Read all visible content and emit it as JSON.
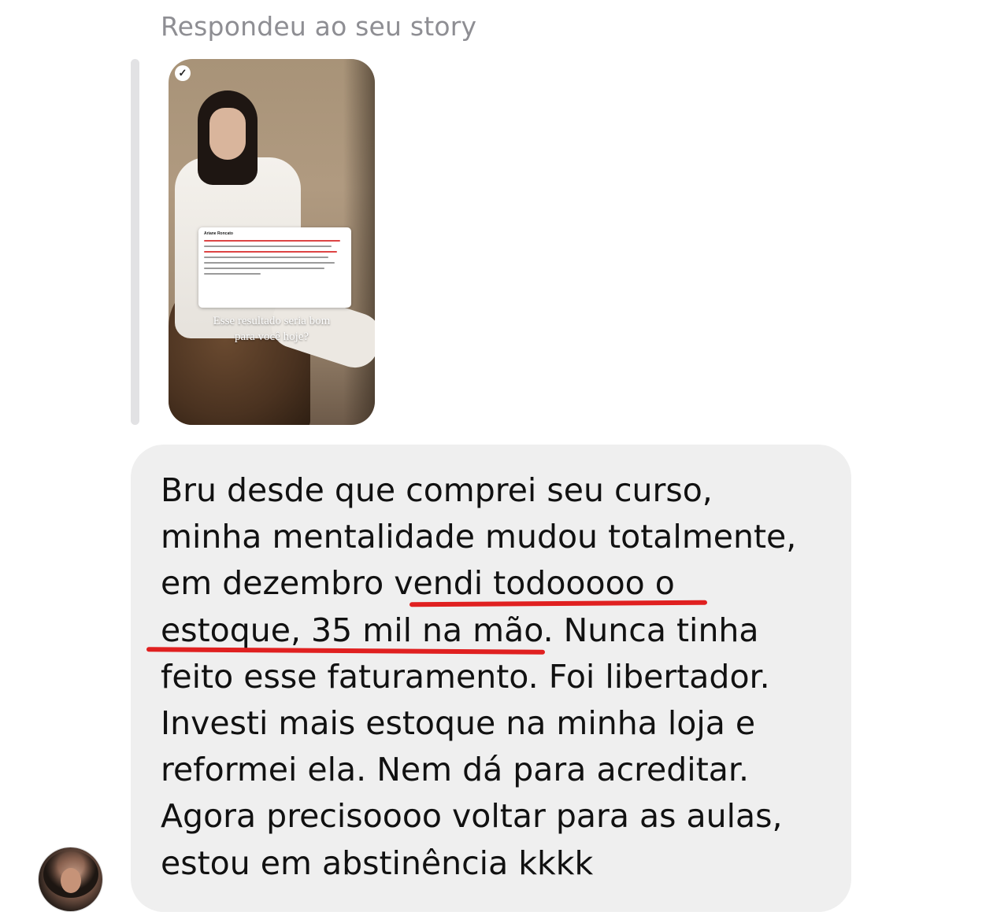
{
  "header": {
    "reply_label": "Respondeu ao seu story"
  },
  "story": {
    "card_name": "Ariane Roncato",
    "caption_line1": "Esse resultado seria bom",
    "caption_line2": "para você hoje?",
    "icon": "check-icon"
  },
  "message": {
    "lines": [
      "Bru desde que comprei seu curso,",
      "minha mentalidade mudou totalmente,",
      "em dezembro vendi todooooo o",
      "estoque, 35 mil na mão. Nunca tinha",
      "feito esse faturamento. Foi libertador.",
      "Investi mais estoque na minha loja e",
      "reformei ela. Nem dá para acreditar.",
      "Agora precisoooo voltar para as aulas,",
      "estou em abstinência kkkk"
    ],
    "underline_color": "#e02020"
  },
  "colors": {
    "bubble": "#efefef",
    "header_text": "#8e8e93",
    "quote_bar": "#e2e2e4"
  }
}
